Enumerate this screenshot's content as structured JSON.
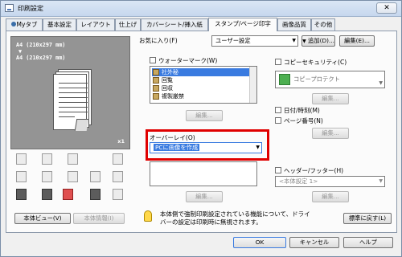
{
  "window": {
    "title": "印刷設定",
    "close_glyph": "✕"
  },
  "tabs": [
    "Myタブ",
    "基本設定",
    "レイアウト",
    "仕上げ",
    "カバーシート/挿入紙",
    "スタンプ/ページ印字",
    "画像品質",
    "その他"
  ],
  "active_tab": 5,
  "preview": {
    "line1": "A4 (210x297 mm)",
    "arrow": "▼",
    "line2": "A4 (210x297 mm)",
    "copies": "x1"
  },
  "left_buttons": {
    "view_label": "本体ビュー(V)",
    "info_label": "本体情報(I)"
  },
  "favorites": {
    "label": "お気に入り(F)",
    "value": "ユーザー設定",
    "add_label": "追加(D)...",
    "edit_label": "編集(E)..."
  },
  "watermark": {
    "label": "ウォーターマーク(W)",
    "items": [
      {
        "text": "社外秘",
        "selected": true
      },
      {
        "text": "回覧",
        "selected": false
      },
      {
        "text": "回収",
        "selected": false
      },
      {
        "text": "複製厳禁",
        "selected": false
      }
    ],
    "edit_label": "編集..."
  },
  "overlay": {
    "label": "オーバーレイ(O)",
    "value": "PCに画像を作成",
    "edit_label": "編集..."
  },
  "copy_security": {
    "label": "コピーセキュリティ(C)",
    "value": "コピープロテクト",
    "edit_label": "編集..."
  },
  "datetime": {
    "label": "日付/時刻(M)"
  },
  "page_number": {
    "label": "ページ番号(N)",
    "edit_label": "編集..."
  },
  "header_footer": {
    "label": "ヘッダー/フッター(H)",
    "value": "<本体設定 1>",
    "edit_label": "編集..."
  },
  "info": {
    "text_line1": "本体側で強制印刷設定されている機能について、ドライ",
    "text_line2": "バーの設定は印刷時に無視されます。",
    "default_label": "標準に戻す(L)"
  },
  "footer": {
    "ok": "OK",
    "cancel": "キャンセル",
    "help": "ヘルプ"
  },
  "colors": {
    "highlight": "#e00000",
    "selection": "#3a7be0"
  }
}
